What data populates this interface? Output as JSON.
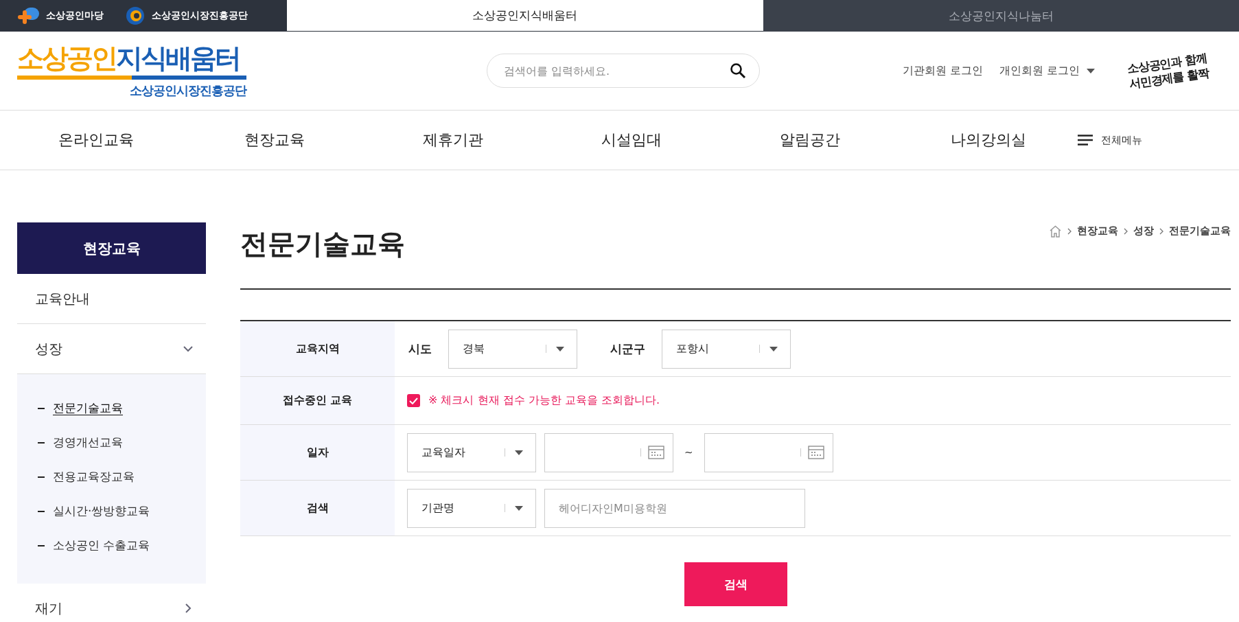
{
  "top_bar": {
    "links": [
      {
        "label": "소상공인마당"
      },
      {
        "label": "소상공인시장진흥공단"
      }
    ],
    "tabs": [
      {
        "label": "소상공인지식배움터",
        "selected": true
      },
      {
        "label": "소상공인지식나눔터",
        "selected": false
      }
    ]
  },
  "header": {
    "logo": {
      "title_part_1": "소상공인",
      "title_part_2": "지식배움터",
      "subtitle": "소상공인시장진흥공단"
    },
    "search": {
      "placeholder": "검색어를 입력하세요."
    },
    "login_links": [
      "기관회원 로그인",
      "개인회원 로그인"
    ],
    "slogan": {
      "line_1": "소상공인과 함께",
      "line_2": "서민경제를 활짝"
    }
  },
  "nav": {
    "items": [
      "온라인교육",
      "현장교육",
      "제휴기관",
      "시설임대",
      "알림공간",
      "나의강의실"
    ],
    "all_menu": "전체메뉴"
  },
  "sidebar": {
    "title": "현장교육",
    "items": [
      {
        "kind": "link",
        "label": "교육안내"
      },
      {
        "kind": "group",
        "label": "성장",
        "expanded": true,
        "children": [
          {
            "label": "전문기술교육",
            "selected": true
          },
          {
            "label": "경영개선교육",
            "selected": false
          },
          {
            "label": "전용교육장교육",
            "selected": false
          },
          {
            "label": "실시간·쌍방향교육",
            "selected": false
          },
          {
            "label": "소상공인 수출교육",
            "selected": false
          }
        ]
      },
      {
        "kind": "group",
        "label": "재기",
        "expanded": false
      }
    ]
  },
  "page": {
    "title": "전문기술교육",
    "breadcrumb": [
      "현장교육",
      "성장",
      "전문기술교육"
    ]
  },
  "form": {
    "rows": [
      {
        "kind": "region",
        "label": "교육지역",
        "fields": [
          {
            "label": "시도",
            "value": "경북"
          },
          {
            "label": "시군구",
            "value": "포항시"
          }
        ]
      },
      {
        "kind": "checkbox",
        "label": "접수중인 교육",
        "checked": true,
        "text": "※ 체크시 현재 접수 가능한 교육을 조회합니다."
      },
      {
        "kind": "date",
        "label": "일자",
        "select": "교육일자",
        "separator": "~"
      },
      {
        "kind": "search",
        "label": "검색",
        "select": "기관명",
        "placeholder": "헤어디자인M미용학원"
      }
    ],
    "submit": "검색"
  }
}
